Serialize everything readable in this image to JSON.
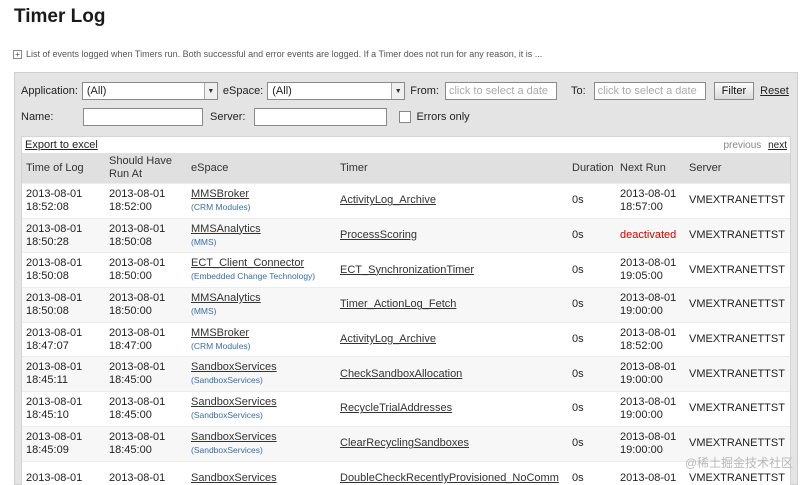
{
  "page": {
    "title": "Timer Log",
    "description": "List of events logged when Timers run. Both successful and error events are logged. If a Timer does not run for any reason, it is ...",
    "expand_symbol": "+"
  },
  "filters": {
    "application_label": "Application:",
    "application_value": "(All)",
    "espace_label": "eSpace:",
    "espace_value": "(All)",
    "from_label": "From:",
    "from_placeholder": "click to select a date",
    "to_label": "To:",
    "to_placeholder": "click to select a date",
    "filter_button": "Filter",
    "reset_link": "Reset",
    "name_label": "Name:",
    "name_value": "",
    "server_label": "Server:",
    "server_value": "",
    "errors_only_label": "Errors only",
    "errors_only_checked": false
  },
  "table": {
    "export_link": "Export to excel",
    "pager_previous": "previous",
    "pager_next": "next",
    "columns": [
      "Time of Log",
      "Should Have Run At",
      "eSpace",
      "Timer",
      "Duration",
      "Next Run",
      "Server"
    ],
    "rows": [
      {
        "log_date": "2013-08-01",
        "log_time": "18:52:08",
        "run_date": "2013-08-01",
        "run_time": "18:52:00",
        "espace": "MMSBroker",
        "espace_sub": "(CRM Modules)",
        "timer": "ActivityLog_Archive",
        "duration": "0s",
        "next_date": "2013-08-01",
        "next_time": "18:57:00",
        "next_deactivated": "",
        "server": "VMEXTRANETTST"
      },
      {
        "log_date": "2013-08-01",
        "log_time": "18:50:28",
        "run_date": "2013-08-01",
        "run_time": "18:50:08",
        "espace": "MMSAnalytics",
        "espace_sub": "(MMS)",
        "timer": "ProcessScoring",
        "duration": "0s",
        "next_date": "",
        "next_time": "",
        "next_deactivated": "deactivated",
        "server": "VMEXTRANETTST"
      },
      {
        "log_date": "2013-08-01",
        "log_time": "18:50:08",
        "run_date": "2013-08-01",
        "run_time": "18:50:00",
        "espace": "ECT_Client_Connector",
        "espace_sub": "(Embedded Change Technology)",
        "timer": "ECT_SynchronizationTimer",
        "duration": "0s",
        "next_date": "2013-08-01",
        "next_time": "19:05:00",
        "next_deactivated": "",
        "server": "VMEXTRANETTST"
      },
      {
        "log_date": "2013-08-01",
        "log_time": "18:50:08",
        "run_date": "2013-08-01",
        "run_time": "18:50:00",
        "espace": "MMSAnalytics",
        "espace_sub": "(MMS)",
        "timer": "Timer_ActionLog_Fetch",
        "duration": "0s",
        "next_date": "2013-08-01",
        "next_time": "19:00:00",
        "next_deactivated": "",
        "server": "VMEXTRANETTST"
      },
      {
        "log_date": "2013-08-01",
        "log_time": "18:47:07",
        "run_date": "2013-08-01",
        "run_time": "18:47:00",
        "espace": "MMSBroker",
        "espace_sub": "(CRM Modules)",
        "timer": "ActivityLog_Archive",
        "duration": "0s",
        "next_date": "2013-08-01",
        "next_time": "18:52:00",
        "next_deactivated": "",
        "server": "VMEXTRANETTST"
      },
      {
        "log_date": "2013-08-01",
        "log_time": "18:45:11",
        "run_date": "2013-08-01",
        "run_time": "18:45:00",
        "espace": "SandboxServices",
        "espace_sub": "(SandboxServices)",
        "timer": "CheckSandboxAllocation",
        "duration": "0s",
        "next_date": "2013-08-01",
        "next_time": "19:00:00",
        "next_deactivated": "",
        "server": "VMEXTRANETTST"
      },
      {
        "log_date": "2013-08-01",
        "log_time": "18:45:10",
        "run_date": "2013-08-01",
        "run_time": "18:45:00",
        "espace": "SandboxServices",
        "espace_sub": "(SandboxServices)",
        "timer": "RecycleTrialAddresses",
        "duration": "0s",
        "next_date": "2013-08-01",
        "next_time": "19:00:00",
        "next_deactivated": "",
        "server": "VMEXTRANETTST"
      },
      {
        "log_date": "2013-08-01",
        "log_time": "18:45:09",
        "run_date": "2013-08-01",
        "run_time": "18:45:00",
        "espace": "SandboxServices",
        "espace_sub": "(SandboxServices)",
        "timer": "ClearRecyclingSandboxes",
        "duration": "0s",
        "next_date": "2013-08-01",
        "next_time": "19:00:00",
        "next_deactivated": "",
        "server": "VMEXTRANETTST"
      },
      {
        "log_date": "2013-08-01",
        "log_time": "",
        "run_date": "2013-08-01",
        "run_time": "",
        "espace": "SandboxServices",
        "espace_sub": "",
        "timer": "DoubleCheckRecentlyProvisioned_NoComm",
        "duration": "0s",
        "next_date": "2013-08-01",
        "next_time": "",
        "next_deactivated": "",
        "server": "VMEXTRANETTST"
      }
    ]
  },
  "watermark": {
    "text": "@稀土掘金技术社区"
  }
}
